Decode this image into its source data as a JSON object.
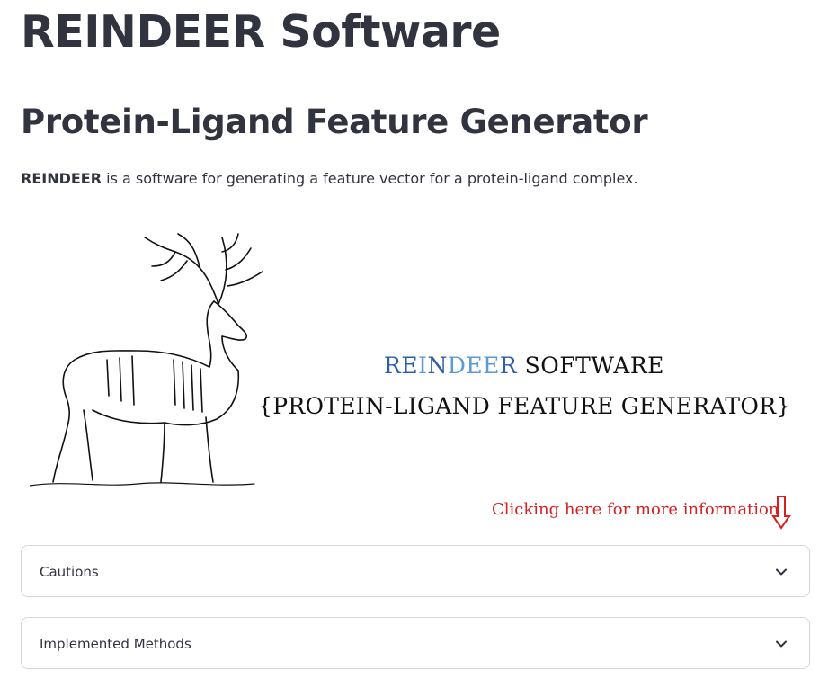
{
  "header": {
    "title": "REINDEER Software",
    "subtitle": "Protein-Ligand Feature Generator"
  },
  "intro": {
    "bold": "REINDEER",
    "rest": " is a software for generating a feature vector for a protein-ligand complex."
  },
  "banner": {
    "image": "reindeer-elk-sketch",
    "logo_line1": [
      "R",
      "E",
      "I",
      "N",
      "D",
      "E",
      "E",
      "R",
      " SOFTWARE"
    ],
    "logo_line2_text": "{PROTEIN-LIGAND FEATURE GENERATOR}"
  },
  "hint": {
    "text": "Clicking here for more information",
    "icon": "arrow-down-outline-icon",
    "color": "#d62020"
  },
  "expanders": [
    {
      "label": "Cautions",
      "icon": "chevron-down-icon"
    },
    {
      "label": "Implemented Methods",
      "icon": "chevron-down-icon"
    }
  ],
  "colors": {
    "text": "#31333f",
    "logo_blue_dark": "#2d5ea8",
    "logo_blue_light": "#5b9bd5",
    "border": "#d6d6d9"
  }
}
